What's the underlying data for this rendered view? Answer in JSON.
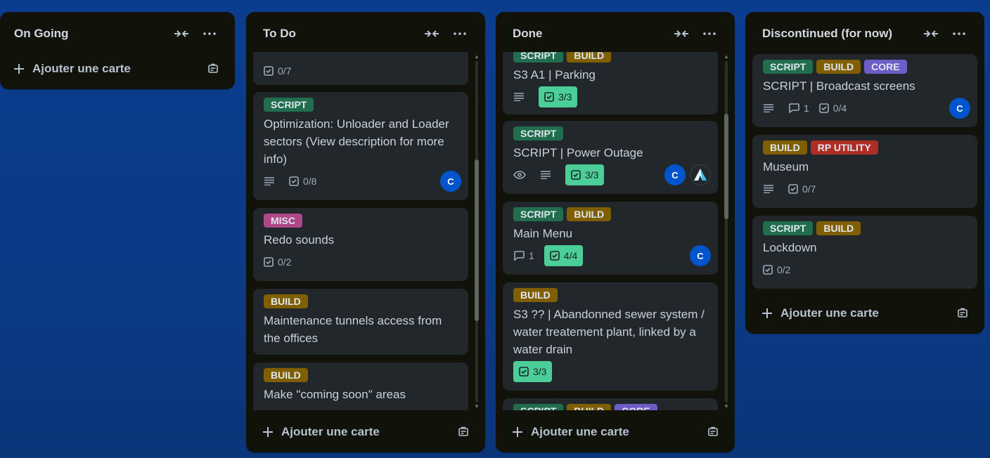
{
  "colors": {
    "script": "#216e4e",
    "build": "#7f5f01",
    "core": "#6e5dc6",
    "misc": "#ae4787",
    "rp_utility": "#ae2e24",
    "checklist_done": "#4bce97",
    "avatar": "#0055cc"
  },
  "add_card_label": "Ajouter une carte",
  "lists": {
    "ongoing": {
      "title": "On Going"
    },
    "todo": {
      "title": "To Do",
      "cards": [
        {
          "checklist": "0/7"
        },
        {
          "labels": [
            "SCRIPT"
          ],
          "title": "Optimization: Unloader and Loader sectors (View description for more info)",
          "checklist": "0/8",
          "avatar": "C"
        },
        {
          "labels": [
            "MISC"
          ],
          "title": "Redo sounds",
          "checklist": "0/2"
        },
        {
          "labels": [
            "BUILD"
          ],
          "title": "Maintenance tunnels access from the offices"
        },
        {
          "labels": [
            "BUILD"
          ],
          "title": "Make \"coming soon\" areas"
        }
      ]
    },
    "done": {
      "title": "Done",
      "cards": [
        {
          "labels": [
            "SCRIPT",
            "BUILD"
          ],
          "title": "S3 A1 | Parking",
          "checklist": "3/3"
        },
        {
          "labels": [
            "SCRIPT"
          ],
          "title": "SCRIPT | Power Outage",
          "checklist": "3/3",
          "avatar": "C"
        },
        {
          "labels": [
            "SCRIPT",
            "BUILD"
          ],
          "title": "Main Menu",
          "comments": "1",
          "checklist": "4/4",
          "avatar": "C"
        },
        {
          "labels": [
            "BUILD"
          ],
          "title": "S3 ?? | Abandonned sewer system / water treatement plant, linked by a water drain",
          "checklist": "3/3"
        },
        {
          "labels": [
            "SCRIPT",
            "BUILD",
            "CORE"
          ]
        }
      ]
    },
    "discontinued": {
      "title": "Discontinued (for now)",
      "cards": [
        {
          "labels": [
            "SCRIPT",
            "BUILD",
            "CORE"
          ],
          "title": "SCRIPT | Broadcast screens",
          "comments": "1",
          "checklist": "0/4",
          "avatar": "C"
        },
        {
          "labels": [
            "BUILD",
            "RP UTILITY"
          ],
          "title": "Museum",
          "checklist": "0/7"
        },
        {
          "labels": [
            "SCRIPT",
            "BUILD"
          ],
          "title": "Lockdown",
          "checklist": "0/2"
        }
      ]
    }
  }
}
